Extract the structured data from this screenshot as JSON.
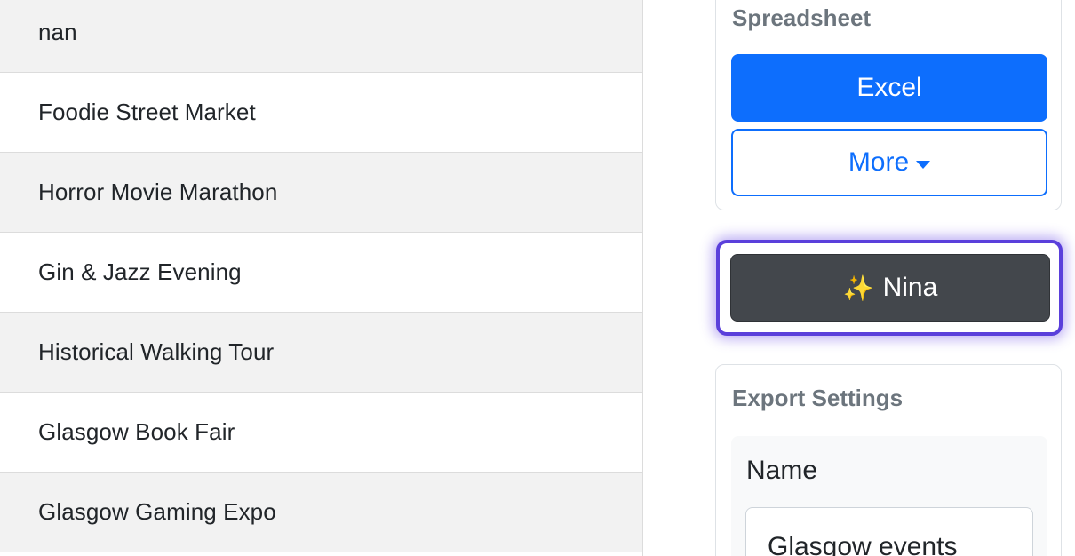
{
  "table": {
    "rows": [
      {
        "name": "nan"
      },
      {
        "name": "Foodie Street Market"
      },
      {
        "name": "Horror Movie Marathon"
      },
      {
        "name": "Gin & Jazz Evening"
      },
      {
        "name": "Historical Walking Tour"
      },
      {
        "name": "Glasgow Book Fair"
      },
      {
        "name": "Glasgow Gaming Expo"
      }
    ]
  },
  "spreadsheet": {
    "title": "Spreadsheet",
    "excel_label": "Excel",
    "more_label": "More"
  },
  "assistant": {
    "sparkle": "✨",
    "label": "Nina"
  },
  "export_settings": {
    "title": "Export Settings",
    "name_label": "Name",
    "name_value": "Glasgow events"
  },
  "colors": {
    "primary": "#0d6efd",
    "dark_button": "#43474c",
    "focus_ring": "#5a3fdb",
    "row_stripe": "#f2f2f2"
  }
}
